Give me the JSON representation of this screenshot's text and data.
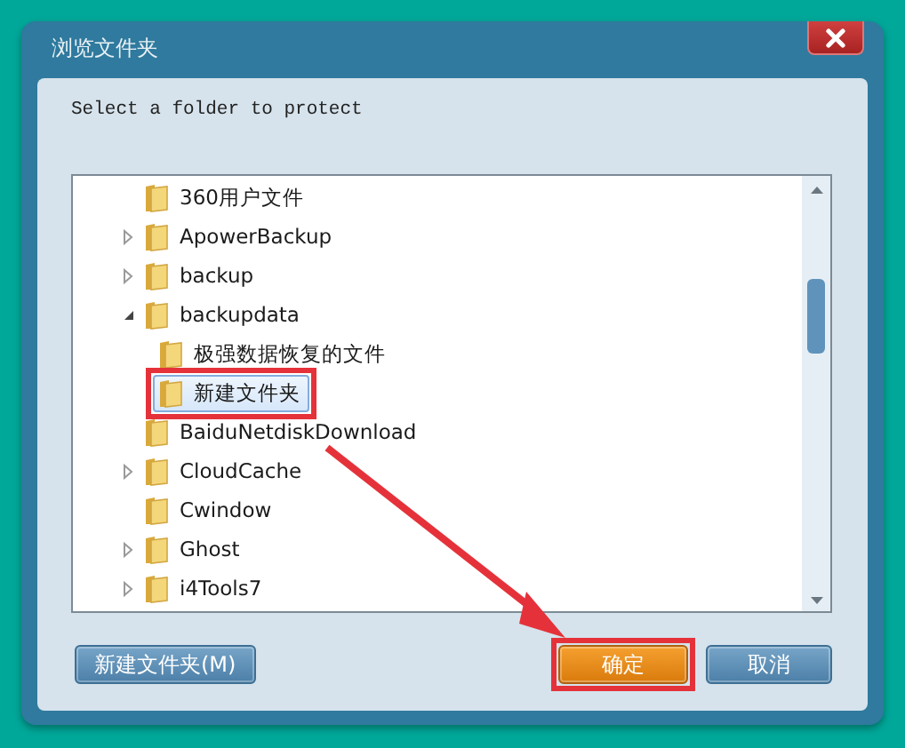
{
  "window": {
    "title": "浏览文件夹"
  },
  "message": "Select a folder to protect",
  "tree": [
    {
      "label": "360用户文件",
      "selected": false,
      "highlighted": false
    },
    {
      "label": "ApowerBackup",
      "expanded": false,
      "selected": false,
      "highlighted": false
    },
    {
      "label": "backup",
      "expanded": false,
      "selected": false,
      "highlighted": false
    },
    {
      "label": "backupdata",
      "expanded": true,
      "selected": false,
      "highlighted": false,
      "children": [
        {
          "label": "极强数据恢复的文件",
          "selected": false,
          "highlighted": false
        },
        {
          "label": "新建文件夹",
          "selected": true,
          "highlighted": true
        }
      ]
    },
    {
      "label": "BaiduNetdiskDownload",
      "selected": false,
      "highlighted": false
    },
    {
      "label": "CloudCache",
      "expanded": false,
      "selected": false,
      "highlighted": false
    },
    {
      "label": "Cwindow",
      "selected": false,
      "highlighted": false
    },
    {
      "label": "Ghost",
      "expanded": false,
      "selected": false,
      "highlighted": false
    },
    {
      "label": "i4Tools7",
      "expanded": false,
      "selected": false,
      "highlighted": false
    }
  ],
  "buttons": [
    {
      "label": "新建文件夹(M)",
      "kind": "secondary",
      "highlighted": false
    },
    {
      "label": "确定",
      "kind": "primary",
      "highlighted": true
    },
    {
      "label": "取消",
      "kind": "secondary",
      "highlighted": false
    }
  ],
  "annotation_arrow": true
}
